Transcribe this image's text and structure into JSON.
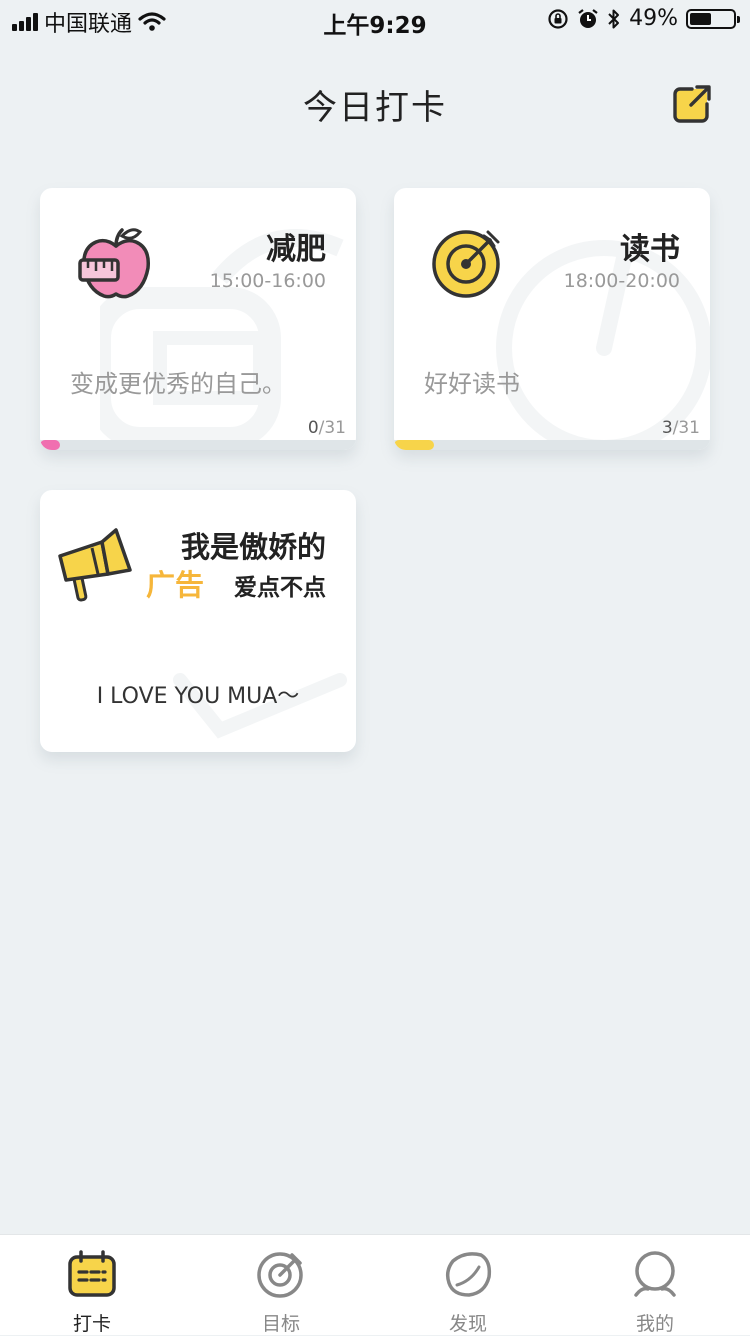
{
  "status_bar": {
    "carrier": "中国联通",
    "time": "上午9:29",
    "battery": "49%",
    "battery_level": 0.49
  },
  "header": {
    "title": "今日打卡",
    "share_icon": "share-out-icon"
  },
  "cards": [
    {
      "title": "减肥",
      "time": "15:00-16:00",
      "description": "变成更优秀的自己。",
      "done": "0",
      "total": "/31",
      "progress": 0.0,
      "accent": "#f06fb0",
      "icon": "apple-tape-measure-icon"
    },
    {
      "title": "读书",
      "time": "18:00-20:00",
      "description": "好好读书",
      "done": "3",
      "total": "/31",
      "progress": 0.0968,
      "accent": "#f7d44a",
      "icon": "target-dart-icon"
    }
  ],
  "ad_card": {
    "line1": "我是傲娇的",
    "highlight": "广告",
    "line2": "爱点不点",
    "slogan": "I LOVE YOU MUA～",
    "highlight_color": "#f6b63a",
    "icon": "megaphone-icon"
  },
  "tabbar": {
    "tabs": [
      {
        "label": "打卡",
        "icon": "calendar-checkin-icon",
        "active": true
      },
      {
        "label": "目标",
        "icon": "target-icon",
        "active": false
      },
      {
        "label": "发现",
        "icon": "planet-icon",
        "active": false
      },
      {
        "label": "我的",
        "icon": "user-icon",
        "active": false
      }
    ]
  },
  "colors": {
    "background": "#edf1f3",
    "brand_yellow": "#f7d44a",
    "pink": "#f06fb0"
  }
}
